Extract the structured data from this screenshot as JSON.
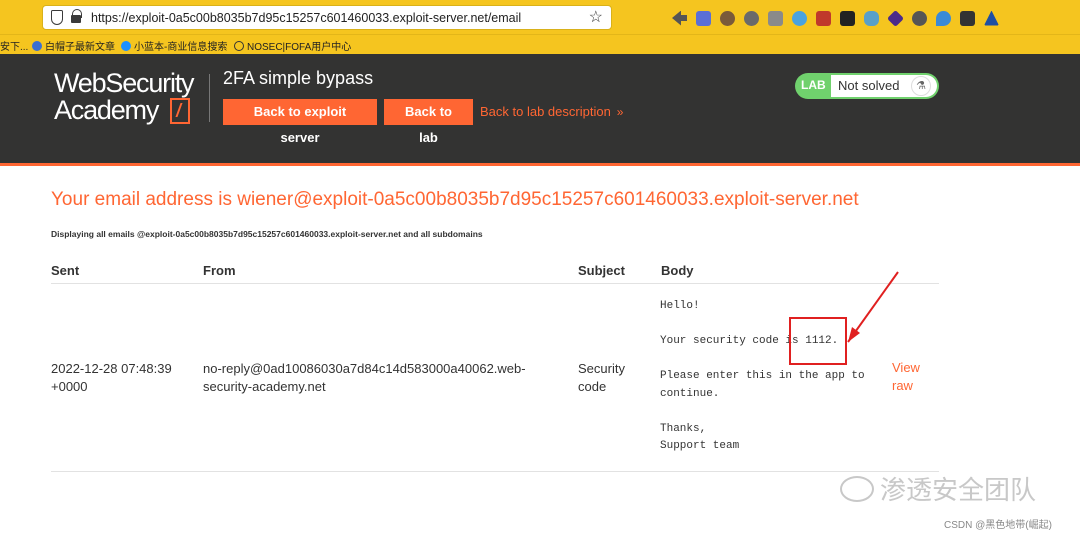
{
  "browser": {
    "url": "https://exploit-0a5c00b8035b7d95c15257c601460033.exploit-server.net/email",
    "bookmarks": [
      {
        "label": "安下..."
      },
      {
        "label": "白帽子最新文章"
      },
      {
        "label": "小蓝本-商业信息搜索"
      },
      {
        "label": "NOSEC|FOFA用户中心"
      }
    ]
  },
  "header": {
    "logo_line1": "WebSecurity",
    "logo_line2": "Academy",
    "lab_title": "2FA simple bypass",
    "btn_exploit": "Back to exploit server",
    "btn_lab": "Back to lab",
    "lab_description_link": "Back to lab description",
    "status_tag": "LAB",
    "status_text": "Not solved"
  },
  "main": {
    "email_heading": "Your email address is wiener@exploit-0a5c00b8035b7d95c15257c601460033.exploit-server.net",
    "displaying_note": "Displaying all emails @exploit-0a5c00b8035b7d95c15257c601460033.exploit-server.net and all subdomains",
    "table": {
      "columns": [
        "Sent",
        "From",
        "Subject",
        "Body"
      ],
      "rows": [
        {
          "sent": "2022-12-28 07:48:39 +0000",
          "from": "no-reply@0ad10086030a7d84c14d583000a40062.web-security-academy.net",
          "subject": "Security code",
          "body": "Hello!\n\nYour security code is 1112.\n\nPlease enter this in the app to continue.\n\nThanks,\nSupport team",
          "view_raw": "View raw"
        }
      ]
    }
  },
  "watermark": {
    "text": "渗透安全团队",
    "csdn": "CSDN @黑色地带(崛起)"
  },
  "colors": {
    "accent": "#ff6633",
    "header_bg": "#333332",
    "browser_bar": "#f5c51f",
    "lab_status": "#70d16d",
    "annotation": "#e02020"
  }
}
